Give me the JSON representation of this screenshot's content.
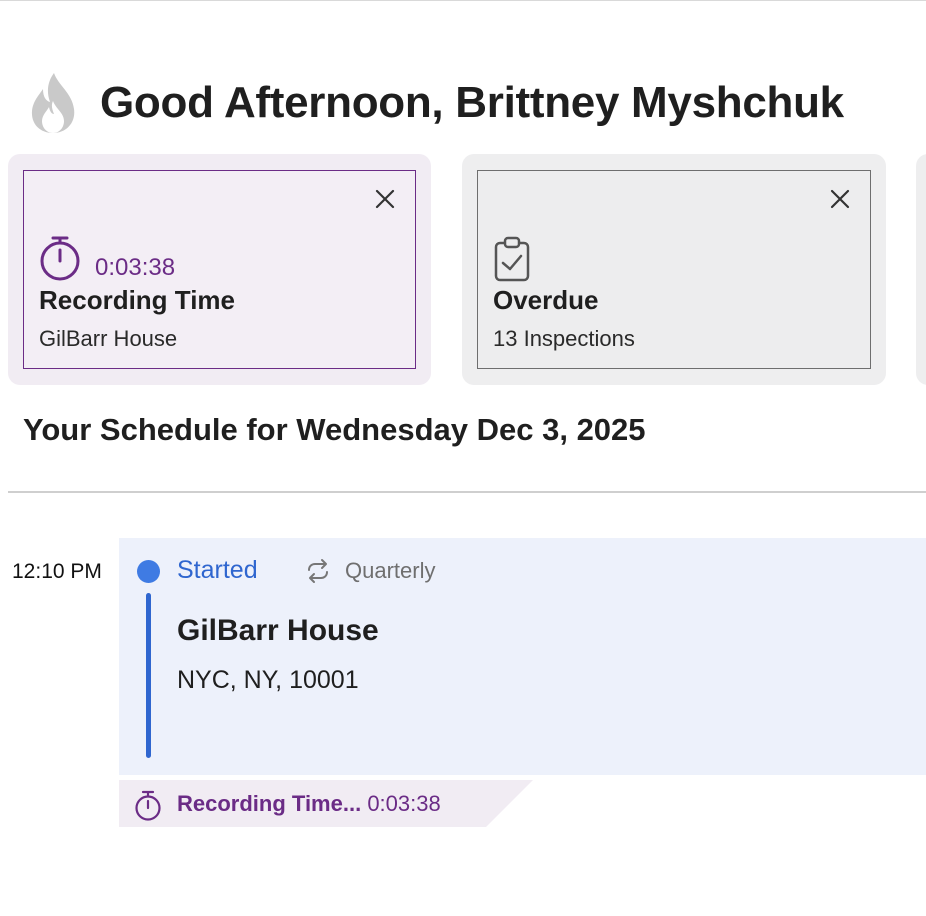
{
  "greeting": {
    "text": "Good Afternoon, Brittney Myshchuk",
    "icon": "flame-icon"
  },
  "cards": [
    {
      "id": "recording",
      "icon": "stopwatch-icon",
      "timer": "0:03:38",
      "title": "Recording Time",
      "subtitle": "GilBarr House",
      "accent": "#6b2c86"
    },
    {
      "id": "overdue",
      "icon": "clipboard-check-icon",
      "title": "Overdue",
      "subtitle": "13 Inspections"
    }
  ],
  "schedule": {
    "title": "Your Schedule for Wednesday Dec 3, 2025",
    "events": [
      {
        "time": "12:10 PM",
        "status": "Started",
        "frequency": "Quarterly",
        "name": "GilBarr House",
        "address": "NYC, NY, 10001",
        "status_color": "#2f66cf"
      }
    ]
  },
  "recording_banner": {
    "label": "Recording Time...",
    "timer": "0:03:38"
  }
}
